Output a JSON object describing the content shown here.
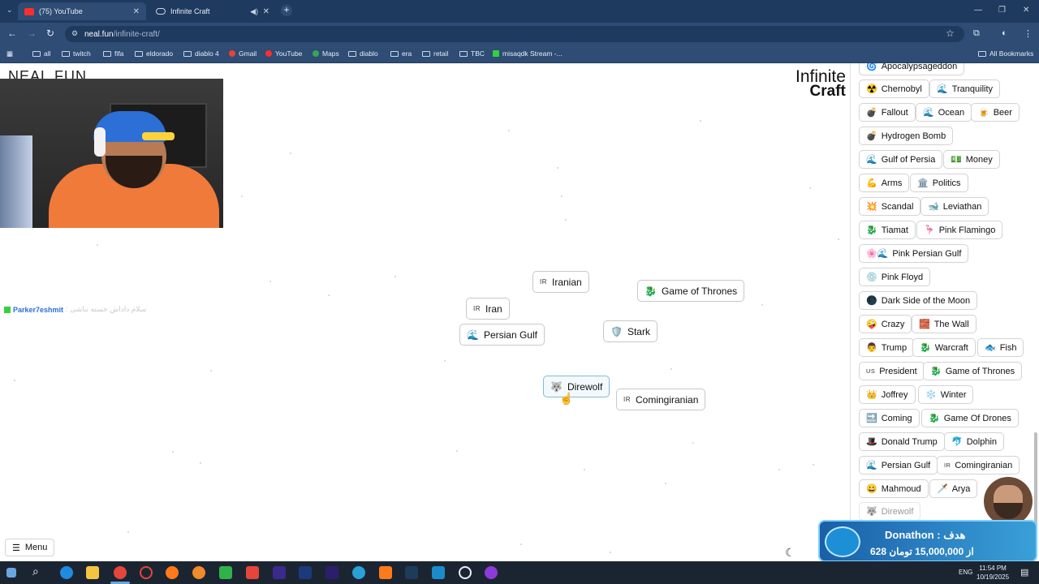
{
  "browser": {
    "tabs": [
      {
        "label": "(75) YouTube"
      },
      {
        "label": "Infinite Craft"
      }
    ],
    "url_host": "neal.fun",
    "url_path": "/infinite-craft/",
    "bookmarks": [
      "all",
      "twitch",
      "fifa",
      "eldorado",
      "diablo 4",
      "Gmail",
      "YouTube",
      "Maps",
      "diablo",
      "era",
      "retail",
      "TBC",
      "misaqdk Stream -..."
    ],
    "all_bookmarks": "All Bookmarks"
  },
  "page": {
    "neal_logo": "NEAL.FUN",
    "logo_line1": "Infinite",
    "logo_line2": "Craft",
    "chat": {
      "user": "Parker7eshmit",
      "message": ": سلام داداش خسته نباشی"
    },
    "menu_label": "Menu"
  },
  "canvas": {
    "chips": [
      {
        "label": "Iranian",
        "icon": "IR",
        "icon_type": "flag-text"
      },
      {
        "label": "Game of Thrones",
        "icon": "🐉",
        "icon_type": "emoji"
      },
      {
        "label": "Iran",
        "icon": "IR",
        "icon_type": "flag-text"
      },
      {
        "label": "Persian Gulf",
        "icon": "🌊",
        "icon_type": "emoji"
      },
      {
        "label": "Stark",
        "icon": "🛡️",
        "icon_type": "emoji"
      },
      {
        "label": "Direwolf",
        "icon": "🐺",
        "icon_type": "emoji"
      },
      {
        "label": "Comingiranian",
        "icon": "IR",
        "icon_type": "flag-text"
      }
    ]
  },
  "sidebar": {
    "items": [
      {
        "label": "Apocalypsageddon",
        "icon": "🌀"
      },
      {
        "label": "Chernobyl",
        "icon": "☢️"
      },
      {
        "label": "Tranquility",
        "icon": "🌊"
      },
      {
        "label": "Fallout",
        "icon": "💣"
      },
      {
        "label": "Ocean",
        "icon": "🌊"
      },
      {
        "label": "Beer",
        "icon": "🍺"
      },
      {
        "label": "Hydrogen Bomb",
        "icon": "💣"
      },
      {
        "label": "Gulf of Persia",
        "icon": "🌊"
      },
      {
        "label": "Money",
        "icon": "💵"
      },
      {
        "label": "Arms",
        "icon": "💪"
      },
      {
        "label": "Politics",
        "icon": "🏛️"
      },
      {
        "label": "Scandal",
        "icon": "💥"
      },
      {
        "label": "Leviathan",
        "icon": "🐋"
      },
      {
        "label": "Tiamat",
        "icon": "🐉"
      },
      {
        "label": "Pink Flamingo",
        "icon": "🦩"
      },
      {
        "label": "Pink Persian Gulf",
        "icon": "🌸🌊"
      },
      {
        "label": "Pink Floyd",
        "icon": "💿"
      },
      {
        "label": "Dark Side of the Moon",
        "icon": "🌑"
      },
      {
        "label": "Crazy",
        "icon": "🤪"
      },
      {
        "label": "The Wall",
        "icon": "🧱"
      },
      {
        "label": "Trump",
        "icon": "👨"
      },
      {
        "label": "Warcraft",
        "icon": "🐉"
      },
      {
        "label": "Fish",
        "icon": "🐟"
      },
      {
        "label": "President",
        "icon": "US"
      },
      {
        "label": "Game of Thrones",
        "icon": "🐉"
      },
      {
        "label": "Joffrey",
        "icon": "👑"
      },
      {
        "label": "Winter",
        "icon": "❄️"
      },
      {
        "label": "Coming",
        "icon": "🔜"
      },
      {
        "label": "Game Of Drones",
        "icon": "🐉"
      },
      {
        "label": "Donald Trump",
        "icon": "🎩"
      },
      {
        "label": "Dolphin",
        "icon": "🐬"
      },
      {
        "label": "Persian Gulf",
        "icon": "🌊"
      },
      {
        "label": "Comingiranian",
        "icon": "IR"
      },
      {
        "label": "Mahmoud",
        "icon": "😀"
      },
      {
        "label": "Arya",
        "icon": "🗡️"
      },
      {
        "label": "Direwolf",
        "icon": "🐺"
      }
    ]
  },
  "overlay": {
    "title": "Donathon : هدف",
    "amount": "628 از 15,000,000 تومان"
  },
  "taskbar": {
    "lang": "ENG",
    "time": "11:54 PM",
    "date": "10/19/2025"
  }
}
